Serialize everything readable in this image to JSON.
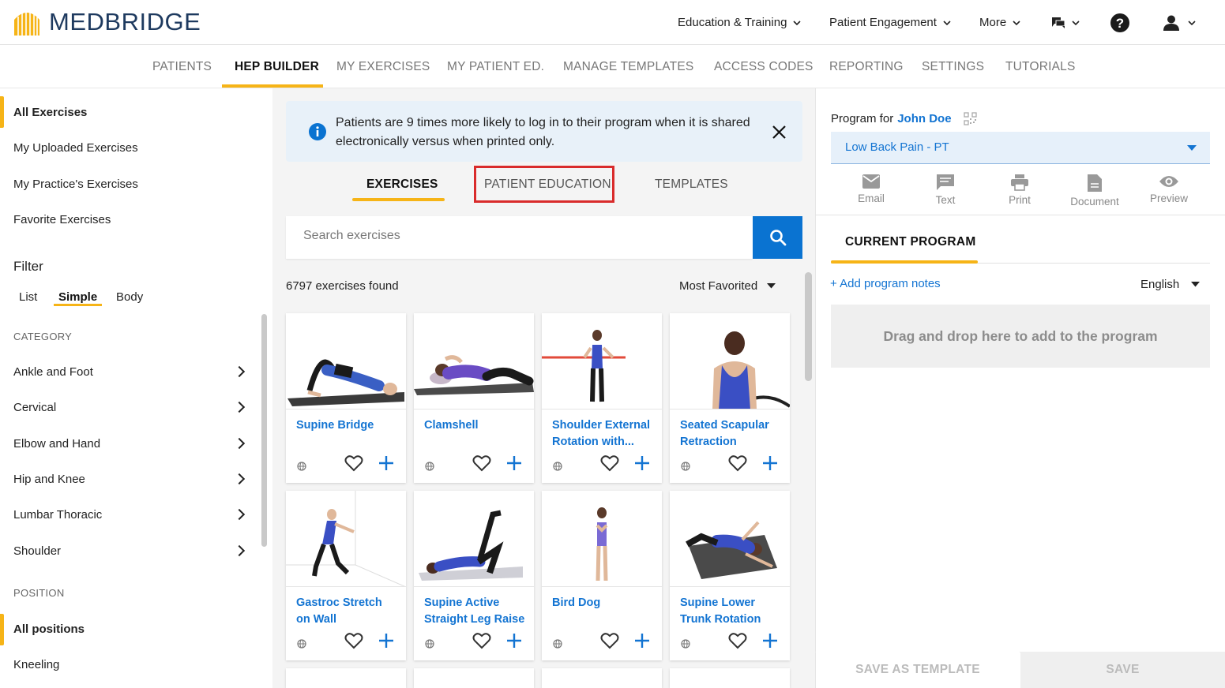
{
  "app": {
    "logo_text": "MEDBRIDGE",
    "brand_color": "#f6b417",
    "accent_color": "#0a73d1"
  },
  "topnav": {
    "education_training": "Education & Training",
    "patient_engagement": "Patient Engagement",
    "more": "More"
  },
  "subnav": [
    {
      "label": "PATIENTS"
    },
    {
      "label": "HEP BUILDER",
      "active": true
    },
    {
      "label": "MY EXERCISES"
    },
    {
      "label": "MY PATIENT ED."
    },
    {
      "label": "MANAGE TEMPLATES"
    },
    {
      "label": "ACCESS CODES"
    },
    {
      "label": "REPORTING"
    },
    {
      "label": "SETTINGS"
    },
    {
      "label": "TUTORIALS"
    }
  ],
  "sidebar": {
    "items": [
      {
        "label": "All Exercises",
        "active": true
      },
      {
        "label": "My Uploaded Exercises"
      },
      {
        "label": "My Practice's Exercises"
      },
      {
        "label": "Favorite Exercises"
      }
    ],
    "filter_heading": "Filter",
    "filter_tabs": [
      {
        "label": "List"
      },
      {
        "label": "Simple",
        "active": true
      },
      {
        "label": "Body"
      }
    ],
    "category_heading": "CATEGORY",
    "categories": [
      {
        "label": "Ankle and Foot"
      },
      {
        "label": "Cervical"
      },
      {
        "label": "Elbow and Hand"
      },
      {
        "label": "Hip and Knee"
      },
      {
        "label": "Lumbar Thoracic"
      },
      {
        "label": "Shoulder"
      }
    ],
    "position_heading": "POSITION",
    "positions": [
      {
        "label": "All positions",
        "active": true
      },
      {
        "label": "Kneeling"
      }
    ]
  },
  "banner": {
    "text": "Patients are 9 times more likely to log in to their program when it is shared electronically versus when printed only."
  },
  "content_tabs": [
    {
      "label": "EXERCISES",
      "active": true
    },
    {
      "label": "PATIENT EDUCATION",
      "highlighted": true
    },
    {
      "label": "TEMPLATES"
    }
  ],
  "search": {
    "placeholder": "Search exercises",
    "value": ""
  },
  "results": {
    "count_text": "6797 exercises found",
    "sort_label": "Most Favorited"
  },
  "exercises": [
    {
      "title": "Supine Bridge"
    },
    {
      "title": "Clamshell"
    },
    {
      "title": "Shoulder External Rotation with..."
    },
    {
      "title": "Seated Scapular Retraction"
    },
    {
      "title": "Gastroc Stretch on Wall"
    },
    {
      "title": "Supine Active Straight Leg Raise"
    },
    {
      "title": "Bird Dog"
    },
    {
      "title": "Supine Lower Trunk Rotation"
    }
  ],
  "program": {
    "label": "Program for",
    "patient_name": "John Doe",
    "selected_program": "Low Back Pain - PT",
    "actions": [
      {
        "label": "Email",
        "icon": "email-icon"
      },
      {
        "label": "Text",
        "icon": "message-icon"
      },
      {
        "label": "Print",
        "icon": "print-icon"
      },
      {
        "label": "Document",
        "icon": "document-icon"
      },
      {
        "label": "Preview",
        "icon": "eye-icon"
      }
    ],
    "current_program_label": "CURRENT PROGRAM",
    "add_notes": "+ Add program notes",
    "language": "English",
    "dropzone_text": "Drag and drop here to add to the program",
    "save_as_template": "SAVE AS TEMPLATE",
    "save": "SAVE"
  }
}
